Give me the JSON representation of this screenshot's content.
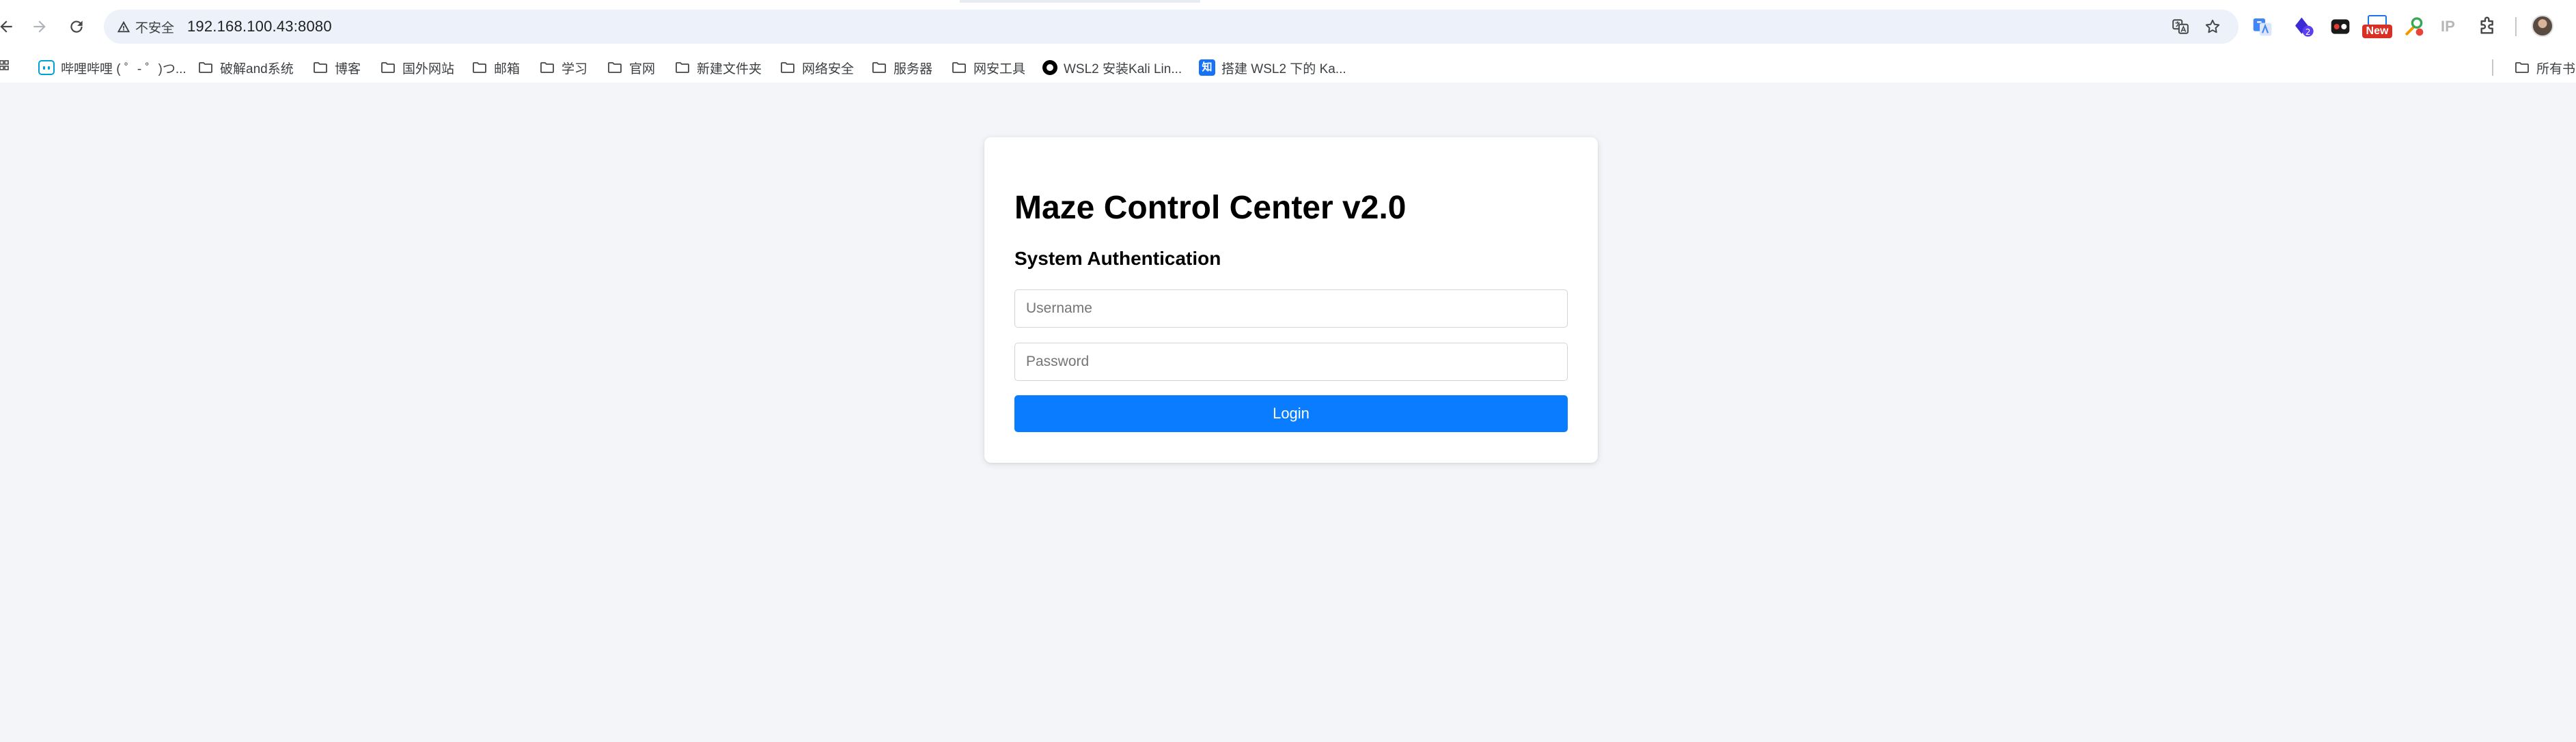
{
  "browser": {
    "security_label": "不安全",
    "url": "192.168.100.43:8080",
    "extensions": {
      "new_badge": "New",
      "ip_label": "IP"
    }
  },
  "bookmarks": {
    "items": [
      {
        "label": "哔哩哔哩 ( ゜- ゜)つ...",
        "icon": "bilibili-icon"
      },
      {
        "label": "破解and系统",
        "icon": "folder-icon"
      },
      {
        "label": "博客",
        "icon": "folder-icon"
      },
      {
        "label": "国外网站",
        "icon": "folder-icon"
      },
      {
        "label": "邮箱",
        "icon": "folder-icon"
      },
      {
        "label": "学习",
        "icon": "folder-icon"
      },
      {
        "label": "官网",
        "icon": "folder-icon"
      },
      {
        "label": "新建文件夹",
        "icon": "folder-icon"
      },
      {
        "label": "网络安全",
        "icon": "folder-icon"
      },
      {
        "label": "服务器",
        "icon": "folder-icon"
      },
      {
        "label": "网安工具",
        "icon": "folder-icon"
      },
      {
        "label": "WSL2 安装Kali Lin...",
        "icon": "github-icon"
      },
      {
        "label": "搭建 WSL2 下的 Ka...",
        "icon": "zhihu-icon"
      }
    ],
    "all_bookmarks": "所有书"
  },
  "login": {
    "title": "Maze Control Center v2.0",
    "subtitle": "System Authentication",
    "username_placeholder": "Username",
    "password_placeholder": "Password",
    "button_label": "Login"
  },
  "colors": {
    "page_background": "#f4f5f9",
    "card_background": "#ffffff",
    "button": "#0a7cff",
    "button_text": "#ffffff",
    "omnibox": "#edf2fa"
  }
}
